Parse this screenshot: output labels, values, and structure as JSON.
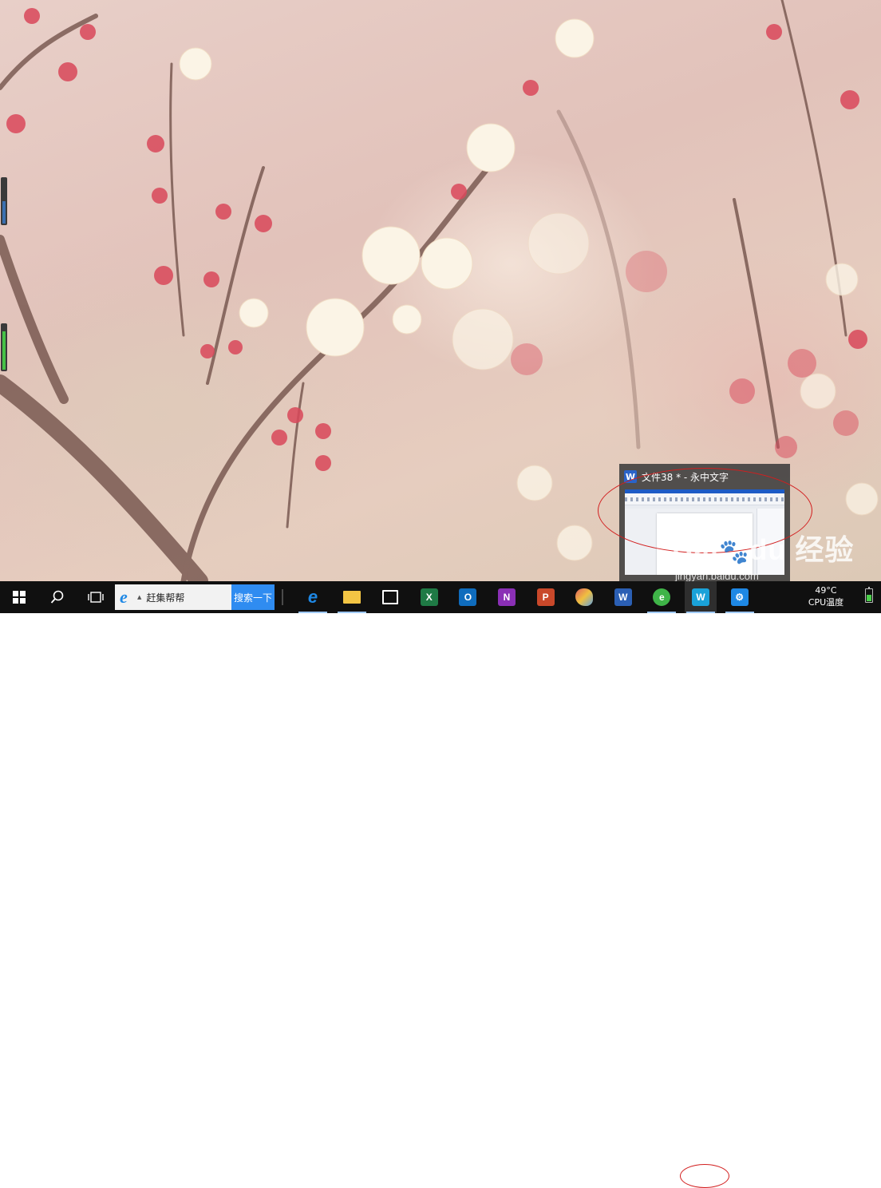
{
  "desktop": {
    "gadget_low_level": 0.5,
    "gadget_high_level": 0.85
  },
  "preview": {
    "title": "文件38 * - 永中文字",
    "app_icon": "yozo-writer-icon"
  },
  "watermark": {
    "logo": "Bai du 经验",
    "url": "jingyan.baidu.com"
  },
  "taskbar": {
    "start_icon": "windows-logo-icon",
    "search_icon": "search-icon",
    "taskview_icon": "task-view-icon",
    "search_box": {
      "value": "赶集帮帮",
      "button": "搜索一下"
    },
    "apps": [
      {
        "name": "edge",
        "icon": "edge-icon",
        "glyph": "e",
        "color": "#1e88e5"
      },
      {
        "name": "file-explorer",
        "icon": "folder-icon",
        "glyph": "",
        "color": "#f3c544"
      },
      {
        "name": "store",
        "icon": "store-icon",
        "glyph": "",
        "color": "#ffffff"
      },
      {
        "name": "excel",
        "icon": "excel-icon",
        "glyph": "X",
        "color": "#1f7a45"
      },
      {
        "name": "outlook",
        "icon": "outlook-icon",
        "glyph": "O",
        "color": "#0f6cbd"
      },
      {
        "name": "onenote",
        "icon": "onenote-icon",
        "glyph": "N",
        "color": "#8a2fb5"
      },
      {
        "name": "powerpoint",
        "icon": "powerpoint-icon",
        "glyph": "P",
        "color": "#c9482a"
      },
      {
        "name": "paint",
        "icon": "palette-icon",
        "glyph": "",
        "color": "#7aa5c8"
      },
      {
        "name": "word",
        "icon": "word-icon",
        "glyph": "W",
        "color": "#2b5fb4"
      },
      {
        "name": "browser-360",
        "icon": "browser-360-icon",
        "glyph": "e",
        "color": "#3fb448"
      },
      {
        "name": "yozo-writer",
        "icon": "yozo-writer-icon",
        "glyph": "W",
        "color": "#1aa2d9"
      },
      {
        "name": "settings",
        "icon": "gear-icon",
        "glyph": "⚙",
        "color": "#1e88e5"
      }
    ],
    "tray": {
      "temp": "49°C",
      "temp_label": "CPU温度",
      "battery_icon": "battery-icon",
      "battery_level": 0.6
    }
  }
}
